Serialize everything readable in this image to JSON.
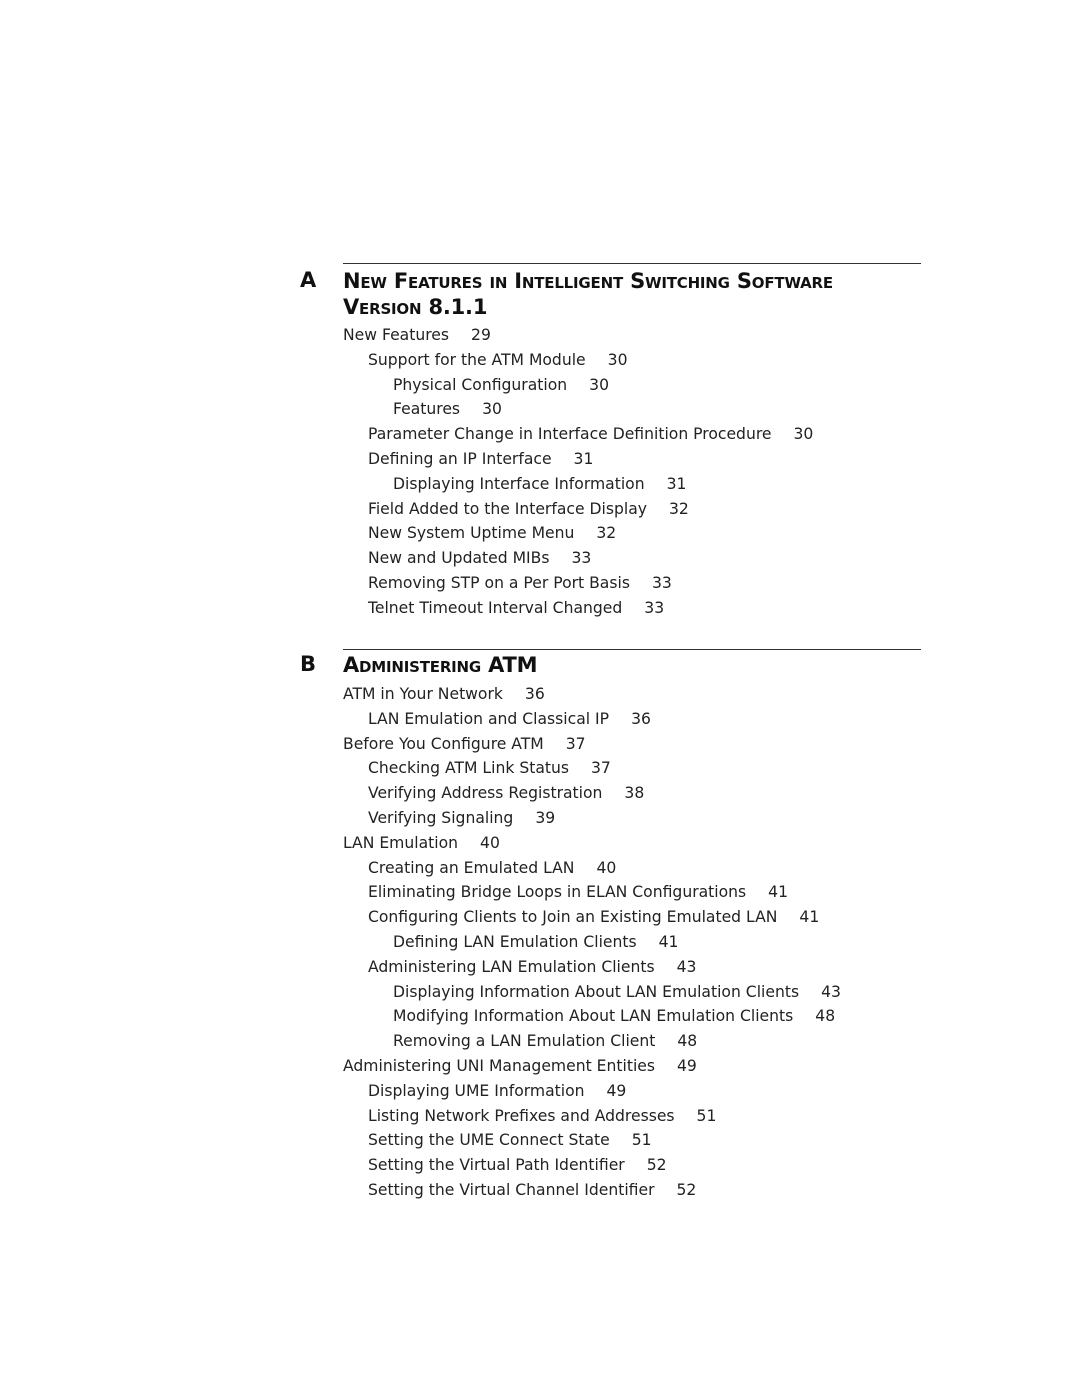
{
  "sections": [
    {
      "letter": "A",
      "title_line1": "New Features in Intelligent Switching Software",
      "title_line2": "Version 8.1.1",
      "entries": [
        {
          "level": 1,
          "text": "New Features",
          "page": "29"
        },
        {
          "level": 2,
          "text": "Support for the ATM Module",
          "page": "30"
        },
        {
          "level": 3,
          "text": "Physical Configuration",
          "page": "30"
        },
        {
          "level": 3,
          "text": "Features",
          "page": "30"
        },
        {
          "level": 2,
          "text": "Parameter Change in Interface Definition Procedure",
          "page": "30"
        },
        {
          "level": 2,
          "text": "Defining an IP Interface",
          "page": "31"
        },
        {
          "level": 3,
          "text": "Displaying Interface Information",
          "page": "31"
        },
        {
          "level": 2,
          "text": "Field Added to the Interface Display",
          "page": "32"
        },
        {
          "level": 2,
          "text": "New System Uptime Menu",
          "page": "32"
        },
        {
          "level": 2,
          "text": "New and Updated MIBs",
          "page": "33"
        },
        {
          "level": 2,
          "text": "Removing STP on a Per Port Basis",
          "page": "33"
        },
        {
          "level": 2,
          "text": "Telnet Timeout Interval Changed",
          "page": "33"
        }
      ]
    },
    {
      "letter": "B",
      "title_line1": "Administering ATM",
      "entries": [
        {
          "level": 1,
          "text": "ATM in Your Network",
          "page": "36"
        },
        {
          "level": 2,
          "text": "LAN Emulation and Classical IP",
          "page": "36"
        },
        {
          "level": 1,
          "text": "Before You Configure ATM",
          "page": "37"
        },
        {
          "level": 2,
          "text": "Checking ATM Link Status",
          "page": "37"
        },
        {
          "level": 2,
          "text": "Verifying Address Registration",
          "page": "38"
        },
        {
          "level": 2,
          "text": "Verifying Signaling",
          "page": "39"
        },
        {
          "level": 1,
          "text": "LAN Emulation",
          "page": "40"
        },
        {
          "level": 2,
          "text": "Creating an Emulated LAN",
          "page": "40"
        },
        {
          "level": 2,
          "text": "Eliminating Bridge Loops in ELAN Configurations",
          "page": "41"
        },
        {
          "level": 2,
          "text": "Configuring Clients to Join an Existing Emulated LAN",
          "page": "41"
        },
        {
          "level": 3,
          "text": "Defining LAN Emulation Clients",
          "page": "41"
        },
        {
          "level": 2,
          "text": "Administering LAN Emulation Clients",
          "page": "43"
        },
        {
          "level": 3,
          "text": "Displaying Information About LAN Emulation Clients",
          "page": "43"
        },
        {
          "level": 3,
          "text": "Modifying Information About LAN Emulation Clients",
          "page": "48"
        },
        {
          "level": 3,
          "text": "Removing a LAN Emulation Client",
          "page": "48"
        },
        {
          "level": 1,
          "text": "Administering UNI Management Entities",
          "page": "49"
        },
        {
          "level": 2,
          "text": "Displaying UME Information",
          "page": "49"
        },
        {
          "level": 2,
          "text": "Listing Network Prefixes and Addresses",
          "page": "51"
        },
        {
          "level": 2,
          "text": "Setting the UME Connect State",
          "page": "51"
        },
        {
          "level": 2,
          "text": "Setting the Virtual Path Identifier",
          "page": "52"
        },
        {
          "level": 2,
          "text": "Setting the Virtual Channel Identifier",
          "page": "52"
        }
      ]
    }
  ]
}
